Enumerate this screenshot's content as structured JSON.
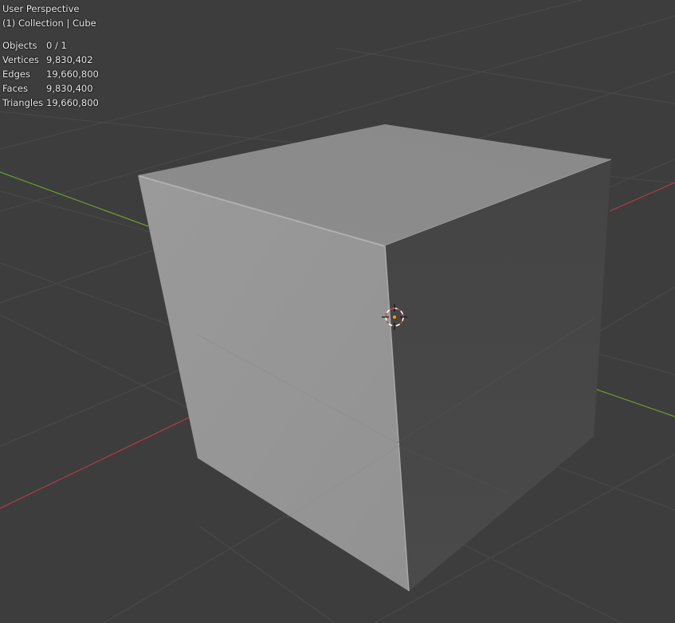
{
  "viewport": {
    "view_name": "User Perspective",
    "collection_label": "(1) Collection | Cube"
  },
  "stats": [
    {
      "label": "Objects",
      "value": "0 / 1"
    },
    {
      "label": "Vertices",
      "value": "9,830,402"
    },
    {
      "label": "Edges",
      "value": "19,660,800"
    },
    {
      "label": "Faces",
      "value": "9,830,400"
    },
    {
      "label": "Triangles",
      "value": "19,660,800"
    }
  ],
  "colors": {
    "background": "#3d3d3d",
    "grid": "#4a4a4a",
    "x_axis": "#b3394a",
    "y_axis": "#6d9a2e",
    "cube_front": "#969696",
    "cube_top": "#8b8b8b",
    "cube_side": "#474747",
    "origin": "#f29b1d"
  },
  "icons": [
    "object-origin-icon"
  ]
}
